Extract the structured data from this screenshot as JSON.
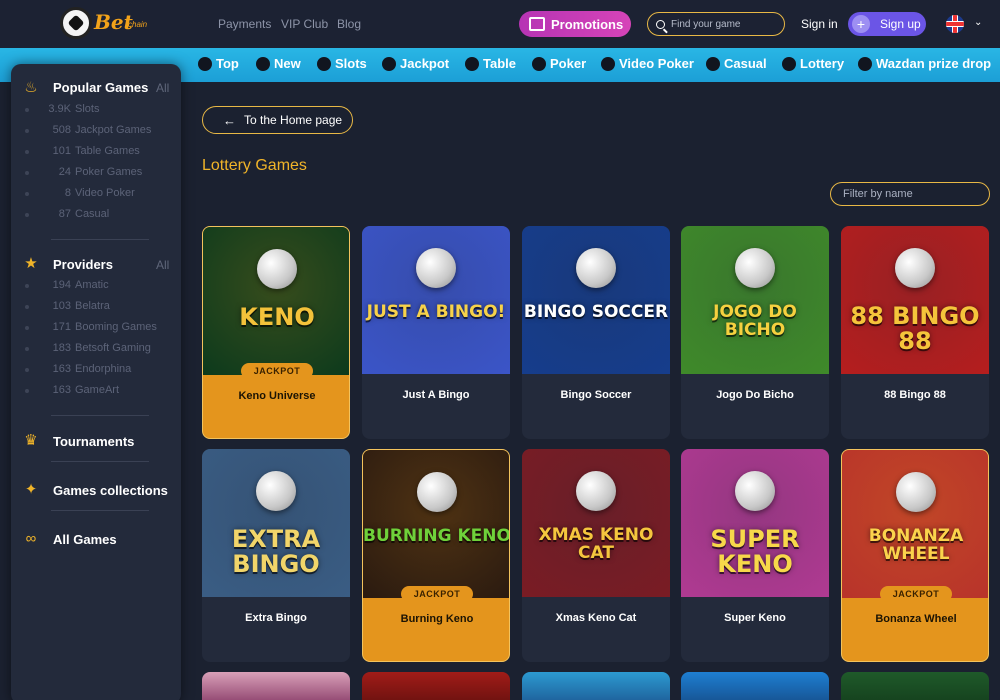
{
  "header": {
    "logo_text": "Bet",
    "logo_sub": "chain",
    "nav": [
      "Payments",
      "VIP Club",
      "Blog"
    ],
    "promotions_label": "Promotions",
    "search_placeholder": "Find your game",
    "signin_label": "Sign in",
    "signup_label": "Sign up",
    "language_icon": "uk-flag-icon"
  },
  "categories": [
    {
      "label": "Top",
      "icon": "thumbs-up-icon"
    },
    {
      "label": "New",
      "icon": "new-badge-icon"
    },
    {
      "label": "Slots",
      "icon": "slot-machine-icon"
    },
    {
      "label": "Jackpot",
      "icon": "jackpot-icon"
    },
    {
      "label": "Table",
      "icon": "dice-icon"
    },
    {
      "label": "Poker",
      "icon": "spade-icon"
    },
    {
      "label": "Video Poker",
      "icon": "video-poker-icon"
    },
    {
      "label": "Casual",
      "icon": "casual-icon"
    },
    {
      "label": "Lottery",
      "icon": "ticket-icon"
    },
    {
      "label": "Wazdan prize drop",
      "icon": "wazdan-icon"
    }
  ],
  "sidebar": {
    "popular": {
      "title": "Popular Games",
      "all": "All",
      "items": [
        {
          "count": "3.9K",
          "name": "Slots"
        },
        {
          "count": "508",
          "name": "Jackpot Games"
        },
        {
          "count": "101",
          "name": "Table Games"
        },
        {
          "count": "24",
          "name": "Poker Games"
        },
        {
          "count": "8",
          "name": "Video Poker"
        },
        {
          "count": "87",
          "name": "Casual"
        }
      ]
    },
    "providers": {
      "title": "Providers",
      "all": "All",
      "items": [
        {
          "count": "194",
          "name": "Amatic"
        },
        {
          "count": "103",
          "name": "Belatra"
        },
        {
          "count": "171",
          "name": "Booming Games"
        },
        {
          "count": "183",
          "name": "Betsoft Gaming"
        },
        {
          "count": "163",
          "name": "Endorphina"
        },
        {
          "count": "163",
          "name": "GameArt"
        }
      ]
    },
    "links": [
      "Tournaments",
      "Games collections",
      "All Games"
    ]
  },
  "main": {
    "home_button": "To the Home page",
    "title": "Lottery Games",
    "filter_placeholder": "Filter by name",
    "jackpot_label": "JACKPOT",
    "games": [
      {
        "name": "Keno Universe",
        "art": "KENO",
        "jackpot": true,
        "bg": "#0c3a1c",
        "color": "#f3c23a"
      },
      {
        "name": "Just A Bingo",
        "art": "JUST A BINGO!",
        "jackpot": false,
        "bg": "#3b55c8",
        "color": "#f7d24a"
      },
      {
        "name": "Bingo Soccer",
        "art": "BINGO SOCCER",
        "jackpot": false,
        "bg": "#163d8c",
        "color": "#ffffff"
      },
      {
        "name": "Jogo Do Bicho",
        "art": "JOGO DO BICHO",
        "jackpot": false,
        "bg": "#3f8a2a",
        "color": "#f6d13f"
      },
      {
        "name": "88 Bingo 88",
        "art": "88 BINGO 88",
        "jackpot": false,
        "bg": "#b51e1e",
        "color": "#f5c43b"
      },
      {
        "name": "Extra Bingo",
        "art": "EXTRA BINGO",
        "jackpot": false,
        "bg": "#3a5d84",
        "color": "#f1d56a"
      },
      {
        "name": "Burning Keno",
        "art": "BURNING KENO",
        "jackpot": true,
        "bg": "#2a1a10",
        "color": "#6fd13a"
      },
      {
        "name": "Xmas Keno Cat",
        "art": "XMAS KENO CAT",
        "jackpot": false,
        "bg": "#7a1c24",
        "color": "#f5c63e"
      },
      {
        "name": "Super Keno",
        "art": "SUPER KENO",
        "jackpot": false,
        "bg": "#b03a92",
        "color": "#f7d84a"
      },
      {
        "name": "Bonanza Wheel",
        "art": "BONANZA WHEEL",
        "jackpot": true,
        "bg": "#b8332a",
        "color": "#fbd34c"
      }
    ]
  }
}
